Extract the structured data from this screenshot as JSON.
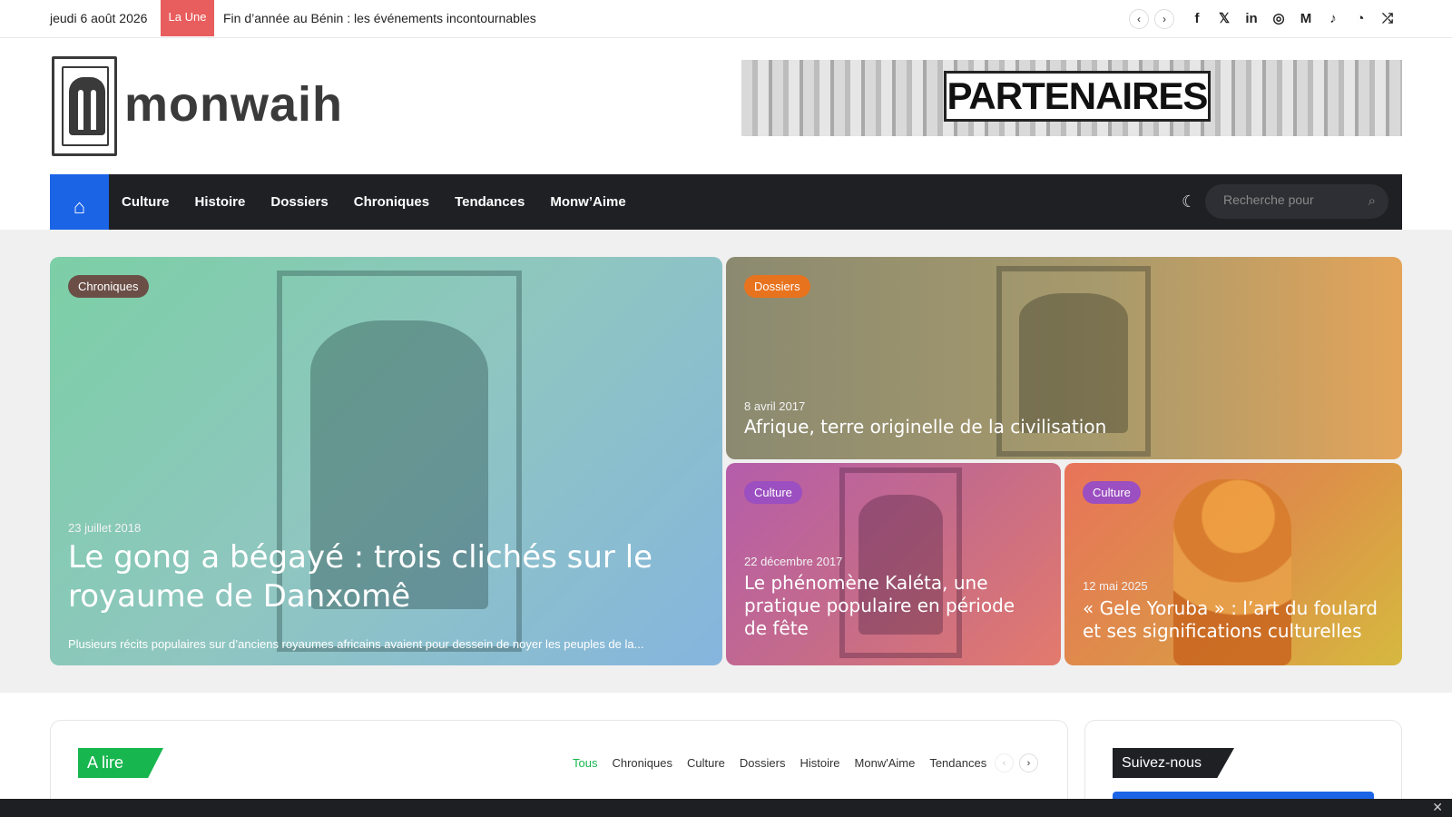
{
  "topbar": {
    "date": "jeudi 6 août 2026",
    "badge": "La Une",
    "ticker": "Fin d’année au Bénin : les événements incontournables",
    "prev_icon": "‹",
    "next_icon": "›",
    "socials": [
      {
        "name": "facebook-icon",
        "glyph": "f"
      },
      {
        "name": "x-icon",
        "glyph": "𝕏"
      },
      {
        "name": "linkedin-icon",
        "glyph": "in"
      },
      {
        "name": "instagram-icon",
        "glyph": "◎"
      },
      {
        "name": "medium-icon",
        "glyph": "M"
      },
      {
        "name": "tiktok-icon",
        "glyph": "♪"
      },
      {
        "name": "rss-icon",
        "glyph": "◔"
      },
      {
        "name": "shuffle-icon",
        "glyph": "⤮"
      }
    ]
  },
  "header": {
    "logo_text": "monwaih",
    "partners_label": "PARTENAIRES"
  },
  "nav": {
    "home_icon": "⌂",
    "items": [
      "Culture",
      "Histoire",
      "Dossiers",
      "Chroniques",
      "Tendances",
      "Monw’Aime"
    ],
    "moon_icon": "☾",
    "search_placeholder": "Recherche pour",
    "search_icon": "⌕"
  },
  "featured": [
    {
      "category": "Chroniques",
      "category_color": "#6b4f47",
      "date": "23 juillet 2018",
      "title": "Le gong a bégayé : trois clichés sur le royaume de Danxomê",
      "excerpt": "Plusieurs récits populaires sur d’anciens royaumes africains avaient pour dessein de noyer les peuples de la..."
    },
    {
      "category": "Dossiers",
      "category_color": "#e8731e",
      "date": "8 avril 2017",
      "title": "Afrique, terre originelle de la civilisation"
    },
    {
      "category": "Culture",
      "category_color": "#9b4fc0",
      "date": "22 décembre 2017",
      "title": "Le phénomène Kaléta, une pratique populaire en période de fête"
    },
    {
      "category": "Culture",
      "category_color": "#9b4fc0",
      "date": "12 mai 2025",
      "title": "« Gele Yoruba » : l’art du foulard et ses significations culturelles"
    }
  ],
  "a_lire": {
    "heading": "A lire",
    "tabs": [
      "Tous",
      "Chroniques",
      "Culture",
      "Dossiers",
      "Histoire",
      "Monw'Aime",
      "Tendances"
    ],
    "active_tab": "Tous"
  },
  "follow": {
    "heading": "Suivez-nous"
  },
  "colors": {
    "accent_blue": "#1b64e6",
    "nav_dark": "#1f2024",
    "green": "#18b64f",
    "badge_red": "#e85d5d"
  },
  "close_icon": "✕"
}
